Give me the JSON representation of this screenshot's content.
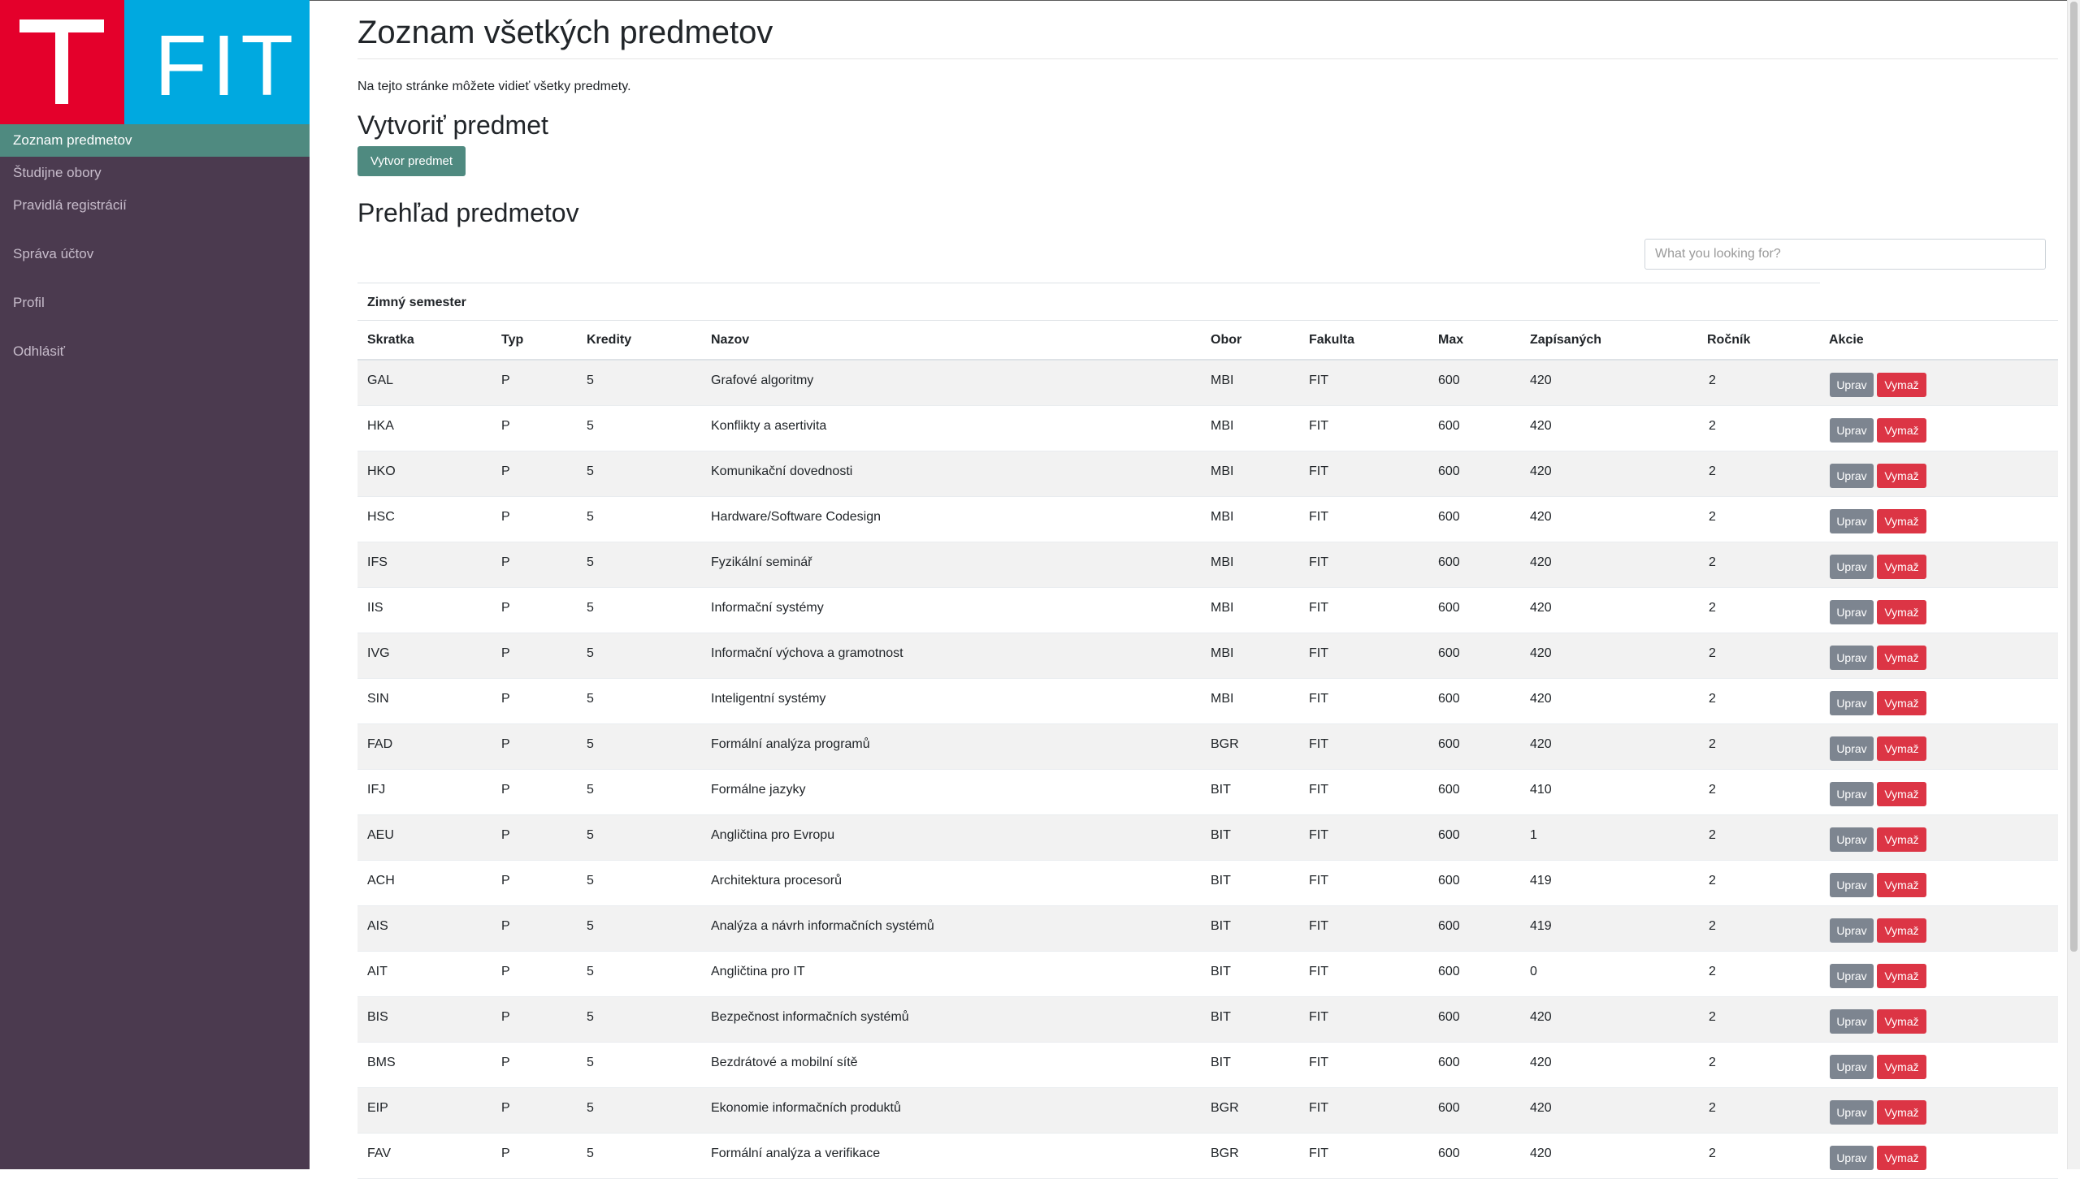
{
  "sidebar": {
    "logo_text": "FIT",
    "items": [
      {
        "label": "Zoznam predmetov",
        "active": true
      },
      {
        "label": "Študijne obory"
      },
      {
        "label": "Pravidlá registrácií"
      },
      {
        "label": "Správa účtov"
      },
      {
        "label": "Profil"
      },
      {
        "label": "Odhlásiť"
      }
    ]
  },
  "page": {
    "title": "Zoznam všetkých predmetov",
    "lead": "Na tejto stránke môžete vidieť všetky predmety.",
    "create_heading": "Vytvoriť predmet",
    "create_button": "Vytvor predmet",
    "overview_heading": "Prehľad predmetov"
  },
  "search": {
    "placeholder": "What you looking for?"
  },
  "table": {
    "semester": "Zimný semester",
    "columns": [
      "Skratka",
      "Typ",
      "Kredity",
      "Nazov",
      "Obor",
      "Fakulta",
      "Max",
      "Zapísaných",
      "Ročník",
      "Akcie"
    ],
    "edit_label": "Uprav",
    "delete_label": "Vymaž",
    "rows": [
      [
        "GAL",
        "P",
        "5",
        "Grafové algoritmy",
        "MBI",
        "FIT",
        "600",
        "420",
        "2"
      ],
      [
        "HKA",
        "P",
        "5",
        "Konflikty a asertivita",
        "MBI",
        "FIT",
        "600",
        "420",
        "2"
      ],
      [
        "HKO",
        "P",
        "5",
        "Komunikační dovednosti",
        "MBI",
        "FIT",
        "600",
        "420",
        "2"
      ],
      [
        "HSC",
        "P",
        "5",
        "Hardware/Software Codesign",
        "MBI",
        "FIT",
        "600",
        "420",
        "2"
      ],
      [
        "IFS",
        "P",
        "5",
        "Fyzikální seminář",
        "MBI",
        "FIT",
        "600",
        "420",
        "2"
      ],
      [
        "IIS",
        "P",
        "5",
        "Informační systémy",
        "MBI",
        "FIT",
        "600",
        "420",
        "2"
      ],
      [
        "IVG",
        "P",
        "5",
        "Informační výchova a gramotnost",
        "MBI",
        "FIT",
        "600",
        "420",
        "2"
      ],
      [
        "SIN",
        "P",
        "5",
        "Inteligentní systémy",
        "MBI",
        "FIT",
        "600",
        "420",
        "2"
      ],
      [
        "FAD",
        "P",
        "5",
        "Formální analýza programů",
        "BGR",
        "FIT",
        "600",
        "420",
        "2"
      ],
      [
        "IFJ",
        "P",
        "5",
        "Formálne jazyky",
        "BIT",
        "FIT",
        "600",
        "410",
        "2"
      ],
      [
        "AEU",
        "P",
        "5",
        "Angličtina pro Evropu",
        "BIT",
        "FIT",
        "600",
        "1",
        "2"
      ],
      [
        "ACH",
        "P",
        "5",
        "Architektura procesorů",
        "BIT",
        "FIT",
        "600",
        "419",
        "2"
      ],
      [
        "AIS",
        "P",
        "5",
        "Analýza a návrh informačních systémů",
        "BIT",
        "FIT",
        "600",
        "419",
        "2"
      ],
      [
        "AIT",
        "P",
        "5",
        "Angličtina pro IT",
        "BIT",
        "FIT",
        "600",
        "0",
        "2"
      ],
      [
        "BIS",
        "P",
        "5",
        "Bezpečnost informačních systémů",
        "BIT",
        "FIT",
        "600",
        "420",
        "2"
      ],
      [
        "BMS",
        "P",
        "5",
        "Bezdrátové a mobilní sítě",
        "BIT",
        "FIT",
        "600",
        "420",
        "2"
      ],
      [
        "EIP",
        "P",
        "5",
        "Ekonomie informačních produktů",
        "BGR",
        "FIT",
        "600",
        "420",
        "2"
      ],
      [
        "FAV",
        "P",
        "5",
        "Formální analýza a verifikace",
        "BGR",
        "FIT",
        "600",
        "420",
        "2"
      ]
    ]
  }
}
